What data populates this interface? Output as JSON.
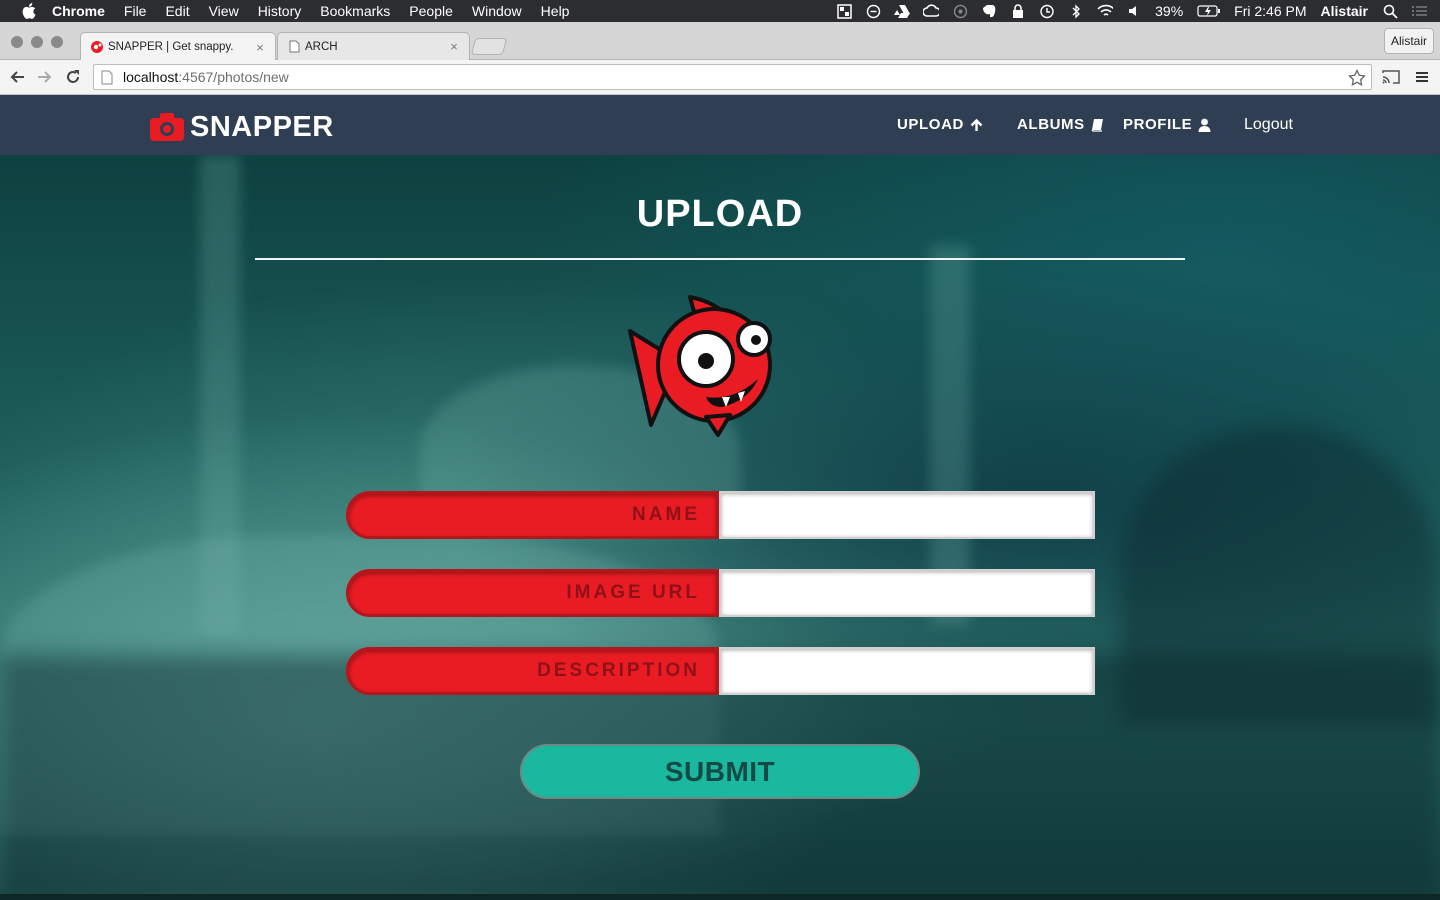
{
  "menubar": {
    "app_name": "Chrome",
    "menus": [
      "File",
      "Edit",
      "View",
      "History",
      "Bookmarks",
      "People",
      "Window",
      "Help"
    ],
    "battery": "39%",
    "clock": "Fri 2:46 PM",
    "user": "Alistair"
  },
  "browser": {
    "tabs": [
      {
        "label": "SNAPPER | Get snappy.",
        "icon": "snapper-favicon",
        "active": true
      },
      {
        "label": "ARCH",
        "icon": "document-icon",
        "active": false
      }
    ],
    "profile_button": "Alistair",
    "url_host": "localhost",
    "url_path": ":4567/photos/new"
  },
  "site": {
    "brand": "SNAPPER",
    "nav": {
      "upload": "UPLOAD",
      "albums": "ALBUMS",
      "profile": "PROFILE",
      "logout": "Logout"
    }
  },
  "form": {
    "title": "UPLOAD",
    "fields": [
      {
        "label": "NAME",
        "value": ""
      },
      {
        "label": "IMAGE URL",
        "value": ""
      },
      {
        "label": "DESCRIPTION",
        "value": ""
      }
    ],
    "submit_label": "SUBMIT"
  },
  "colors": {
    "nav_bg": "#2f3e52",
    "brand_red": "#e91c24",
    "submit_teal": "#1ab89e"
  }
}
